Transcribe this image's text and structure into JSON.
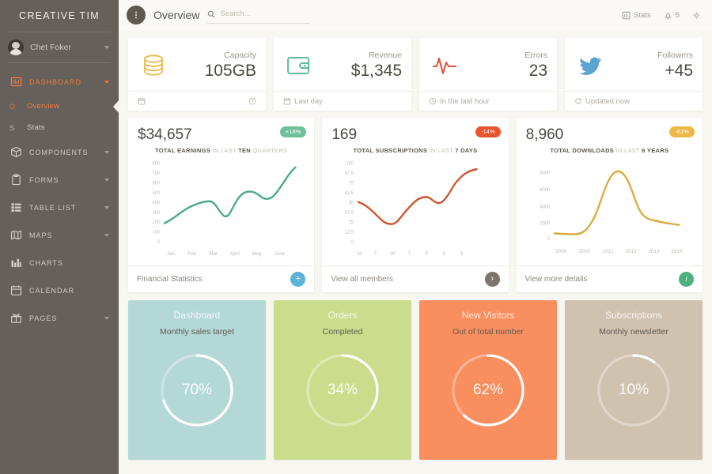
{
  "sidebar": {
    "brand": "CREATIVE TIM",
    "user": {
      "name": "Chet Foker",
      "avatar": "user-avatar"
    },
    "items": [
      {
        "label": "DASHBOARD",
        "icon": "dashboard-icon",
        "active": true,
        "caret": true
      },
      {
        "label": "COMPONENTS",
        "icon": "box-icon",
        "active": false,
        "caret": true
      },
      {
        "label": "FORMS",
        "icon": "clipboard-icon",
        "active": false,
        "caret": true
      },
      {
        "label": "TABLE LIST",
        "icon": "table-icon",
        "active": false,
        "caret": true
      },
      {
        "label": "MAPS",
        "icon": "map-icon",
        "active": false,
        "caret": true
      },
      {
        "label": "CHARTS",
        "icon": "chart-bar-icon",
        "active": false,
        "caret": false
      },
      {
        "label": "CALENDAR",
        "icon": "calendar-icon",
        "active": false,
        "caret": false
      },
      {
        "label": "PAGES",
        "icon": "gift-icon",
        "active": false,
        "caret": true
      }
    ],
    "subitems": [
      {
        "letter": "O",
        "label": "Overview",
        "active": true
      },
      {
        "letter": "S",
        "label": "Stats",
        "active": false
      }
    ]
  },
  "topbar": {
    "menu_icon": "vertical-dots-icon",
    "title": "Overview",
    "search_placeholder": "Search...",
    "search_value": "",
    "stats_label": "Stats",
    "notification_count": "5",
    "settings_icon": "gear-icon"
  },
  "stats": [
    {
      "icon": "database-icon",
      "label": "Capacity",
      "value": "105GB",
      "foot_text": "",
      "foot_icon": "calendar-icon",
      "foot_right_icon": "help-icon",
      "color": "#eaba4a"
    },
    {
      "icon": "wallet-icon",
      "label": "Revenue",
      "value": "$1,345",
      "foot_text": "Last day",
      "foot_icon": "calendar-icon",
      "foot_right_icon": "",
      "color": "#5cb999"
    },
    {
      "icon": "pulse-icon",
      "label": "Errors",
      "value": "23",
      "foot_text": "In the last hour",
      "foot_icon": "clock-icon",
      "foot_right_icon": "",
      "color": "#e2563c"
    },
    {
      "icon": "twitter-icon",
      "label": "Followers",
      "value": "+45",
      "foot_text": "Updated now",
      "foot_icon": "refresh-icon",
      "foot_right_icon": "",
      "color": "#5ba4cf"
    }
  ],
  "charts": [
    {
      "value": "34,657",
      "value_prefix": "$",
      "badge": "+18%",
      "badge_color": "#6fbf9a",
      "title_bold_1": "TOTAL EARNINGS",
      "title_muted_1": "IN LAST",
      "title_bold_2": "TEN",
      "title_muted_2": "QUARTERS",
      "footer_label": "Financial Statistics",
      "footer_button": "+",
      "footer_button_color": "#5bb4d8",
      "footer_button_icon": "plus-icon",
      "line_color": "#4aa98a"
    },
    {
      "value": "169",
      "value_prefix": "",
      "badge": "-14%",
      "badge_color": "#e8542f",
      "title_bold_1": "TOTAL SUBSCRIPTIONS",
      "title_muted_1": "IN LAST",
      "title_bold_2": "7 DAYS",
      "title_muted_2": "",
      "footer_label": "View all members",
      "footer_button": "›",
      "footer_button_color": "#7c756c",
      "footer_button_icon": "chevron-right-icon",
      "line_color": "#cf5530"
    },
    {
      "value": "8,960",
      "value_prefix": "",
      "badge": "-61%",
      "badge_color": "#edb849",
      "title_bold_1": "TOTAL DOWNLOADS",
      "title_muted_1": "IN LAST",
      "title_bold_2": "6 YEARS",
      "title_muted_2": "",
      "footer_label": "View more details",
      "footer_button": "i",
      "footer_button_color": "#4fb080",
      "footer_button_icon": "info-icon",
      "line_color": "#ddaa3c"
    }
  ],
  "chart_data": [
    {
      "type": "line",
      "title": "TOTAL EARNINGS IN LAST TEN QUARTERS",
      "categories": [
        "Jan",
        "Feb",
        "Mar",
        "April",
        "May",
        "June"
      ],
      "x": [
        0,
        1,
        2,
        3,
        4,
        5,
        6,
        7,
        8,
        9
      ],
      "values": [
        200,
        290,
        360,
        370,
        265,
        320,
        530,
        490,
        470,
        765
      ],
      "ylim": [
        0,
        800
      ],
      "yticks": [
        0,
        100,
        200,
        300,
        400,
        500,
        600,
        700,
        800
      ],
      "xlabel": "",
      "ylabel": "",
      "grid": false,
      "legend": "none",
      "color": "#4aa98a"
    },
    {
      "type": "line",
      "title": "TOTAL SUBSCRIPTIONS IN LAST 7 DAYS",
      "categories": [
        "M",
        "T",
        "W",
        "T",
        "F",
        "S",
        "S"
      ],
      "values": [
        53,
        41,
        25,
        43,
        64,
        54,
        87,
        95
      ],
      "ylim": [
        0,
        100
      ],
      "yticks": [
        0,
        12.5,
        25,
        37.5,
        50,
        62.5,
        75,
        87.5,
        100
      ],
      "xlabel": "",
      "ylabel": "",
      "grid": false,
      "legend": "none",
      "color": "#cf5530"
    },
    {
      "type": "line",
      "title": "TOTAL DOWNLOADS IN LAST 6 YEARS",
      "categories": [
        "2009",
        "2010",
        "2011",
        "2012",
        "2013",
        "2014"
      ],
      "values": [
        800,
        700,
        3400,
        8000,
        3100,
        2100
      ],
      "ylim": [
        0,
        8000
      ],
      "yticks": [
        0,
        2000,
        4000,
        6000,
        8000
      ],
      "xlabel": "",
      "ylabel": "",
      "grid": false,
      "legend": "none",
      "color": "#ddaa3c"
    }
  ],
  "progress": [
    {
      "title": "Dashboard",
      "desc": "Monthly sales target",
      "value": "70%",
      "percent": 70,
      "bg": "#b4d8d6",
      "track": "rgba(255,255,255,0.35)",
      "bar": "#ffffff"
    },
    {
      "title": "Orders",
      "desc": "Completed",
      "value": "34%",
      "percent": 34,
      "bg": "#cbdd8c",
      "track": "rgba(255,255,255,0.35)",
      "bar": "#ffffff"
    },
    {
      "title": "New Visitors",
      "desc": "Out of total number",
      "value": "62%",
      "percent": 62,
      "bg": "#f98e5e",
      "track": "rgba(255,255,255,0.35)",
      "bar": "#ffffff"
    },
    {
      "title": "Subscriptions",
      "desc": "Monthly newsletter",
      "value": "10%",
      "percent": 10,
      "bg": "#cfc2ae",
      "track": "rgba(255,255,255,0.35)",
      "bar": "#ffffff"
    }
  ]
}
